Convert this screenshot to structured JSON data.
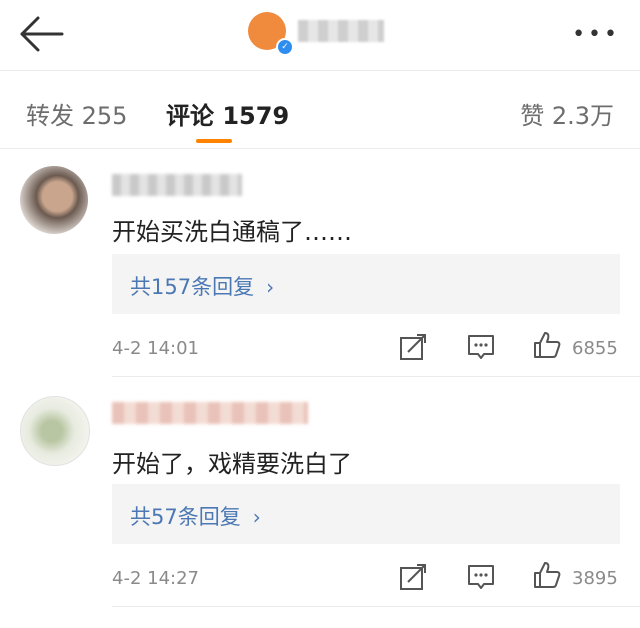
{
  "header": {
    "back_icon": "back-arrow-icon",
    "more_icon": "more-dots-icon",
    "more_label": "•••"
  },
  "tabs": {
    "repost": "转发 255",
    "comment": "评论 1579",
    "like": "赞 2.3万"
  },
  "comments": [
    {
      "text": "开始买洗白通稿了……",
      "replies_label": "共157条回复",
      "time": "4-2 14:01",
      "likes": "6855"
    },
    {
      "text": "开始了，戏精要洗白了",
      "replies_label": "共57条回复",
      "time": "4-2 14:27",
      "likes": "3895"
    }
  ],
  "colors": {
    "accent": "#ff8200",
    "link": "#4b78b3",
    "verify": "#2e8ef0"
  }
}
